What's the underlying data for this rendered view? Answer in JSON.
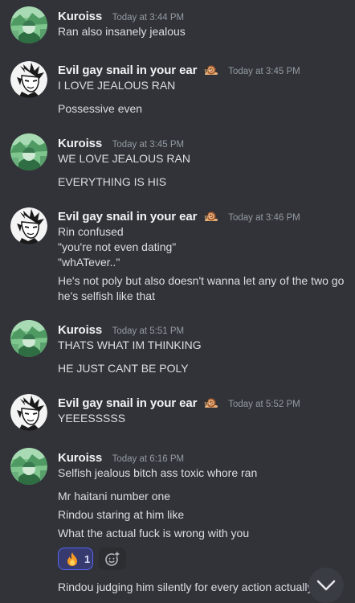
{
  "colors": {
    "background": "#313338",
    "username": "#f2f3f5",
    "timestamp": "#949ba4",
    "message_text": "#dbdee1",
    "reaction_bg": "#373a6e",
    "reaction_border": "#5865f2"
  },
  "messages": [
    {
      "author": "Kuroiss",
      "avatar": "green-anime-avatar",
      "timestamp": "Today at 3:44 PM",
      "lines": [
        "Ran also insanely jealous"
      ]
    },
    {
      "author": "Evil gay snail in your ear",
      "author_icon": "snail-icon",
      "avatar": "monochrome-sketch-avatar",
      "timestamp": "Today at 3:45 PM",
      "lines": [
        "I LOVE JEALOUS RAN",
        "Possessive even"
      ]
    },
    {
      "author": "Kuroiss",
      "avatar": "green-anime-avatar",
      "timestamp": "Today at 3:45 PM",
      "lines": [
        "WE LOVE JEALOUS RAN",
        "EVERYTHING IS HIS"
      ]
    },
    {
      "author": "Evil gay snail in your ear",
      "author_icon": "snail-icon",
      "avatar": "monochrome-sketch-avatar",
      "timestamp": "Today at 3:46 PM",
      "lines": [
        "Rin confused",
        "\"you're not even dating\"",
        "\"whATever..\"",
        "He's not poly but also doesn't wanna let any of the two go",
        "he's selfish like that"
      ]
    },
    {
      "author": "Kuroiss",
      "avatar": "green-anime-avatar",
      "timestamp": "Today at 5:51 PM",
      "lines": [
        "THATS WHAT IM THINKING",
        "HE JUST CANT BE POLY"
      ]
    },
    {
      "author": "Evil gay snail in your ear",
      "author_icon": "snail-icon",
      "avatar": "monochrome-sketch-avatar",
      "timestamp": "Today at 5:52 PM",
      "lines": [
        "YEEESSSSS"
      ]
    },
    {
      "author": "Kuroiss",
      "avatar": "green-anime-avatar",
      "timestamp": "Today at 6:16 PM",
      "lines": [
        "Selfish jealous bitch ass toxic whore ran",
        "Mr haitani number one",
        "Rindou staring at him like",
        "What the actual fuck is wrong with you",
        "Rindou judging him silently for every action actually"
      ],
      "reaction": {
        "emoji": "fire-icon",
        "count": "1"
      },
      "add_reaction_icon": "add-reaction-icon"
    }
  ],
  "jump_button_icon": "chevron-down-icon"
}
